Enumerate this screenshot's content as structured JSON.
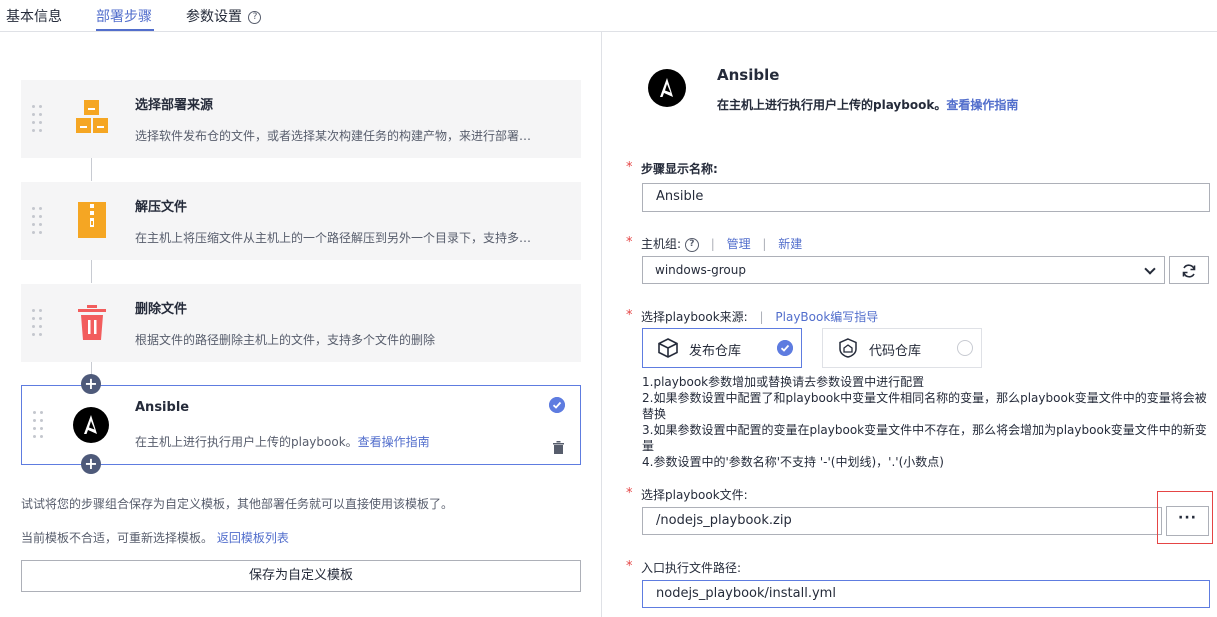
{
  "tabs": [
    {
      "label": "基本信息"
    },
    {
      "label": "部署步骤",
      "active": true
    },
    {
      "label": "参数设置",
      "help": "?"
    }
  ],
  "steps": [
    {
      "title": "选择部署来源",
      "desc": "选择软件发布仓的文件，或者选择某次构建任务的构建产物，来进行部署…",
      "icon": "package-source-icon"
    },
    {
      "title": "解压文件",
      "desc": "在主机上将压缩文件从主机上的一个路径解压到另外一个目录下，支持多…",
      "icon": "zip-file-icon"
    },
    {
      "title": "删除文件",
      "desc": "根据文件的路径删除主机上的文件，支持多个文件的删除",
      "icon": "trash-icon"
    },
    {
      "title": "Ansible",
      "desc": "在主机上进行执行用户上传的playbook。",
      "link": "查看操作指南",
      "icon": "ansible-icon",
      "selected": true
    }
  ],
  "plus_label": "+",
  "hints": {
    "save_hint": "试试将您的步骤组合保存为自定义模板，其他部署任务就可以直接使用该模板了。",
    "reselect_hint": "当前模板不合适，可重新选择模板。",
    "back_link": "返回模板列表"
  },
  "save_template_button": "保存为自定义模板",
  "detail": {
    "title": "Ansible",
    "desc": "在主机上进行执行用户上传的playbook。",
    "guide_link": "查看操作指南",
    "required_mark": "*",
    "step_name": {
      "label": "步骤显示名称:",
      "value": "Ansible"
    },
    "host_group": {
      "label": "主机组:",
      "help": "?",
      "manage": "管理",
      "create": "新建",
      "sep": "|",
      "value": "windows-group"
    },
    "playbook_source": {
      "label": "选择playbook来源:",
      "sep": "|",
      "guide": "PlayBook编写指导",
      "options": [
        {
          "label": "发布仓库",
          "selected": true
        },
        {
          "label": "代码仓库",
          "selected": false
        }
      ]
    },
    "notes": [
      "1.playbook参数增加或替换请去参数设置中进行配置",
      "2.如果参数设置中配置了和playbook中变量文件相同名称的变量，那么playbook变量文件中的变量将会被替换",
      "3.如果参数设置中配置的变量在playbook变量文件中不存在，那么将会增加为playbook变量文件中的新变量",
      "4.参数设置中的'参数名称'不支持 '-'(中划线)，'.'(小数点)"
    ],
    "playbook_file": {
      "label": "选择playbook文件:",
      "value": "/nodejs_playbook.zip",
      "browse": "···"
    },
    "entry_path": {
      "label": "入口执行文件路径:",
      "value": "nodejs_playbook/install.yml"
    }
  },
  "colors": {
    "accent": "#5e7ce0",
    "link": "#526ecc",
    "required": "#e54545",
    "orange": "#f5a623",
    "red": "#f25d5d"
  }
}
